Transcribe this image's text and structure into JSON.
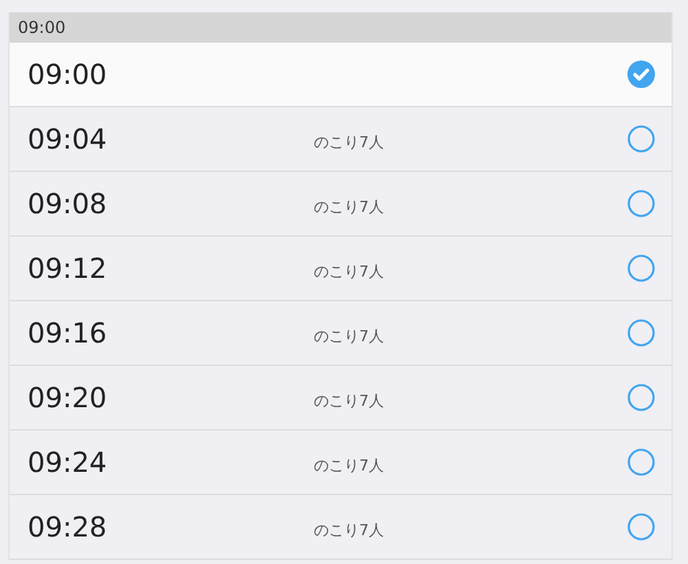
{
  "section": {
    "header": "09:00"
  },
  "slots": [
    {
      "time": "09:00",
      "selected": true
    },
    {
      "time": "09:04",
      "remaining": "のこり7人",
      "selected": false
    },
    {
      "time": "09:08",
      "remaining": "のこり7人",
      "selected": false
    },
    {
      "time": "09:12",
      "remaining": "のこり7人",
      "selected": false
    },
    {
      "time": "09:16",
      "remaining": "のこり7人",
      "selected": false
    },
    {
      "time": "09:20",
      "remaining": "のこり7人",
      "selected": false
    },
    {
      "time": "09:24",
      "remaining": "のこり7人",
      "selected": false
    },
    {
      "time": "09:28",
      "remaining": "のこり7人",
      "selected": false
    }
  ]
}
